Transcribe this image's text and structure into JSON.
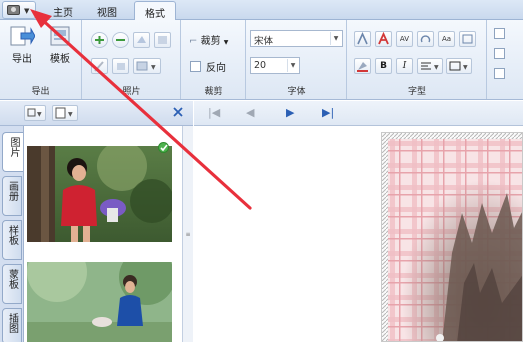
{
  "tabs": {
    "home": "主页",
    "view": "视图",
    "format": "格式"
  },
  "groups": {
    "export": "导出",
    "photo": "照片",
    "crop": "裁剪",
    "font": "字体",
    "fontstyle": "字型"
  },
  "buttons": {
    "export": "导出",
    "template": "模板",
    "crop": "裁剪",
    "reverse": "反向"
  },
  "font": {
    "name": "宋体",
    "size": "20"
  },
  "fontstyle": {
    "bold": "B",
    "italic": "I",
    "av": "AV",
    "aa": "Aa"
  },
  "side_tabs": [
    "图片",
    "画册",
    "样板",
    "蒙板",
    "插图"
  ],
  "colors": {
    "ribbon": "#dde7f4",
    "accent": "#2b5fb4",
    "arrow": "#e8303c"
  }
}
